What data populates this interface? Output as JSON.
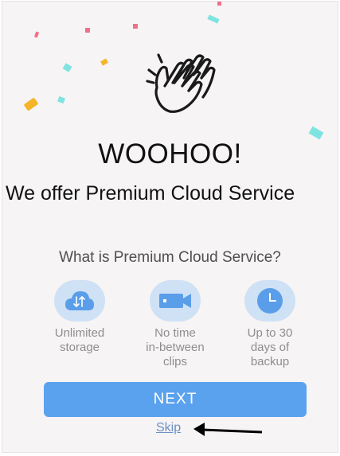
{
  "celebration": {
    "icon": "clapping-hands-icon",
    "headline": "WOOHOO!"
  },
  "offer": {
    "title": "We offer Premium Cloud Service"
  },
  "question": "What is Premium Cloud Service?",
  "features": [
    {
      "icon": "cloud-sync-icon",
      "label": "Unlimited\nstorage"
    },
    {
      "icon": "video-camera-icon",
      "label": "No time\nin-between\nclips"
    },
    {
      "icon": "clock-icon",
      "label": "Up to 30\ndays of\nbackup"
    }
  ],
  "actions": {
    "next_label": "NEXT",
    "skip_label": "Skip"
  },
  "colors": {
    "accent": "#5ba2ee",
    "feature_circle": "#cfe1f5",
    "feature_icon": "#5a9ee9",
    "skip_link": "#6e8fc4",
    "confetti_pink": "#f0708a",
    "confetti_orange": "#f5b52a",
    "confetti_teal": "#7fe4e1"
  }
}
